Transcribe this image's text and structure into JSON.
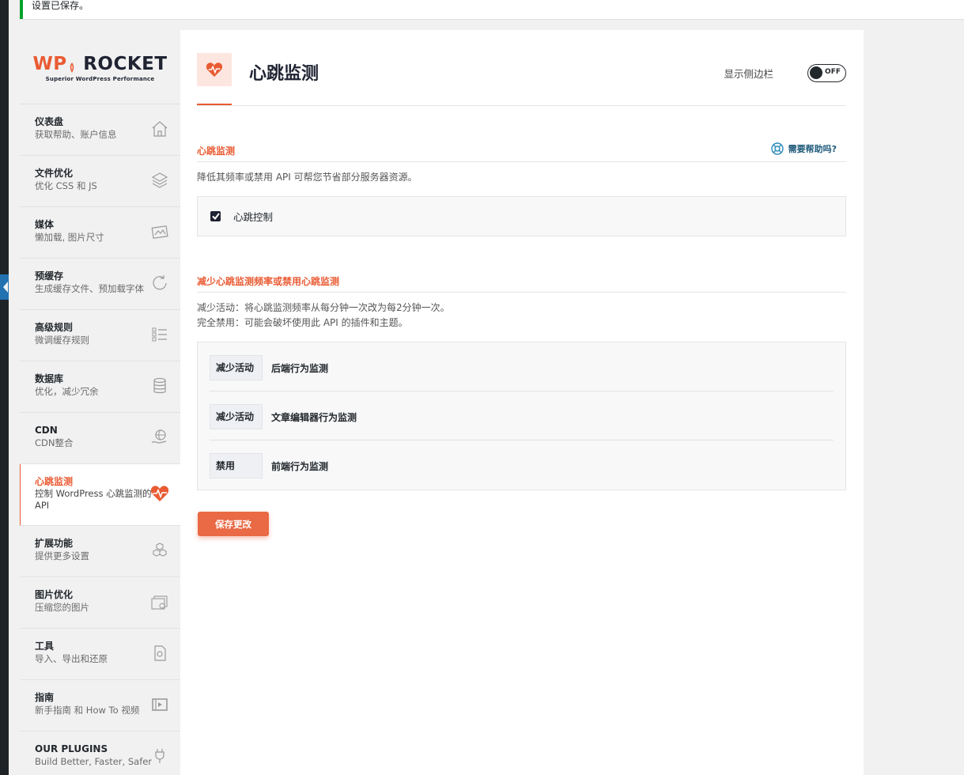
{
  "notice": {
    "text": "设置已保存。"
  },
  "brand": {
    "name_wp": "WP",
    "name_rocket": "ROCKET",
    "tagline": "Superior WordPress Performance",
    "accent": "#e95b33"
  },
  "sidebar": {
    "items": [
      {
        "title": "仪表盘",
        "subtitle": "获取帮助、账户信息",
        "icon": "home-icon"
      },
      {
        "title": "文件优化",
        "subtitle": "优化 CSS 和 JS",
        "icon": "layers-icon"
      },
      {
        "title": "媒体",
        "subtitle": "懒加载, 图片尺寸",
        "icon": "image-icon"
      },
      {
        "title": "预缓存",
        "subtitle": "生成缓存文件、预加载字体",
        "icon": "refresh-icon"
      },
      {
        "title": "高级规则",
        "subtitle": "微调缓存规则",
        "icon": "list-icon"
      },
      {
        "title": "数据库",
        "subtitle": "优化，减少冗余",
        "icon": "database-icon"
      },
      {
        "title": "CDN",
        "subtitle": "CDN整合",
        "icon": "globe-hand-icon"
      },
      {
        "title": "心跳监测",
        "subtitle": "控制 WordPress 心跳监测的 API",
        "icon": "heartbeat-icon",
        "active": true
      },
      {
        "title": "扩展功能",
        "subtitle": "提供更多设置",
        "icon": "cubes-icon"
      },
      {
        "title": "图片优化",
        "subtitle": "压缩您的图片",
        "icon": "images-icon"
      },
      {
        "title": "工具",
        "subtitle": "导入、导出和还原",
        "icon": "tools-icon"
      },
      {
        "title": "指南",
        "subtitle": "新手指南 和 How To 视频",
        "icon": "video-icon"
      },
      {
        "title": "OUR PLUGINS",
        "subtitle": "Build Better, Faster, Safer",
        "icon": "plug-icon"
      }
    ]
  },
  "header": {
    "title": "心跳监测",
    "toggle_label": "显示侧边栏",
    "toggle_state": "OFF"
  },
  "section1": {
    "title": "心跳监测",
    "help": "需要帮助吗?",
    "description": "降低其频率或禁用 API 可帮您节省部分服务器资源。",
    "checkbox_label": "心跳控制",
    "checkbox_checked": true
  },
  "section2": {
    "title": "减少心跳监测频率或禁用心跳监测",
    "desc_line1": "减少活动：将心跳监测频率从每分钟一次改为每2分钟一次。",
    "desc_line2": "完全禁用：可能会破坏使用此 API 的插件和主题。",
    "rows": [
      {
        "value": "减少活动",
        "label": "后端行为监测"
      },
      {
        "value": "减少活动",
        "label": "文章编辑器行为监测"
      },
      {
        "value": "禁用",
        "label": "前端行为监测"
      }
    ]
  },
  "save_button": "保存更改"
}
